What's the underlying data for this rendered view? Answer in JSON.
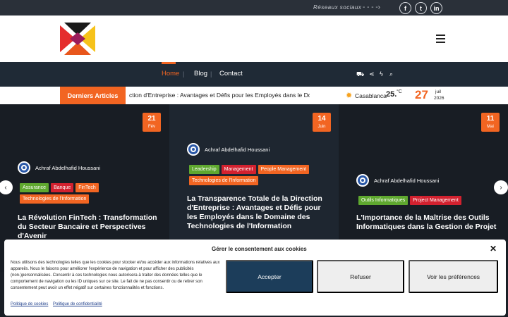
{
  "topbar": {
    "social_label": "Réseaux sociaux",
    "social_icons": [
      {
        "name": "facebook-icon",
        "glyph": "f"
      },
      {
        "name": "twitter-icon",
        "glyph": "t"
      },
      {
        "name": "linkedin-icon",
        "glyph": "in"
      }
    ]
  },
  "nav": {
    "items": [
      {
        "label": "Home",
        "active": true
      },
      {
        "label": "Blog",
        "active": false
      },
      {
        "label": "Contact",
        "active": false
      }
    ]
  },
  "ticker": {
    "label": "Derniers Articles",
    "text": "ction d'Entreprise : Avantages et Défis pour les Employés dans le Domaine",
    "city": "Casablanca",
    "temp": "25.",
    "unit": "°C",
    "day": "27",
    "month": "juil",
    "year": "2026"
  },
  "slides": [
    {
      "day": "21",
      "month": "Fév",
      "author": "Achraf Abdelhafid Houssani",
      "tags": [
        {
          "label": "Assurance",
          "color": "#5fa82f"
        },
        {
          "label": "Banque",
          "color": "#d2212f"
        },
        {
          "label": "FinTech",
          "color": "#f26522"
        },
        {
          "label": "Technologies de l'Information",
          "color": "#f26522"
        }
      ],
      "title": "La Révolution FinTech : Transformation du Secteur Bancaire et Perspectives d'Avenir"
    },
    {
      "day": "14",
      "month": "Juin",
      "author": "Achraf Abdelhafid Houssani",
      "tags": [
        {
          "label": "Leadership",
          "color": "#5fa82f"
        },
        {
          "label": "Management",
          "color": "#d2212f"
        },
        {
          "label": "People Management",
          "color": "#f26522"
        },
        {
          "label": "Technologies de l'Information",
          "color": "#f26522"
        }
      ],
      "title": "La Transparence Totale de la Direction d'Entreprise : Avantages et Défis pour les Employés dans le Domaine des Technologies de l'Information"
    },
    {
      "day": "11",
      "month": "Mai",
      "author": "Achraf Abdelhafid Houssani",
      "tags": [
        {
          "label": "Outils Informatiques",
          "color": "#5fa82f"
        },
        {
          "label": "Project Management",
          "color": "#d2212f"
        }
      ],
      "title": "L'Importance de la Maîtrise des Outils Informatiques dans la Gestion de Projet"
    }
  ],
  "cookie": {
    "title": "Gérer le consentement aux cookies",
    "text": "Nous utilisons des technologies telles que les cookies pour stocker et/ou accéder aux informations relatives aux appareils. Nous le faisons pour améliorer l'expérience de navigation et pour afficher des publicités (non-)personnalisées. Consentir à ces technologies nous autorisera à traiter des données telles que le comportement de navigation ou les ID uniques sur ce site. Le fait de ne pas consentir ou de retirer son consentement peut avoir un effet négatif sur certaines fonctionnalités et fonctions.",
    "accept": "Accepter",
    "refuse": "Refuser",
    "prefs": "Voir les préférences",
    "link_cookies": "Politique de cookies",
    "link_privacy": "Politique de confidentialité"
  },
  "colors": {
    "accent": "#f26522",
    "nav_bg": "#1f2a36",
    "accept_bg": "#1c3d5a"
  }
}
